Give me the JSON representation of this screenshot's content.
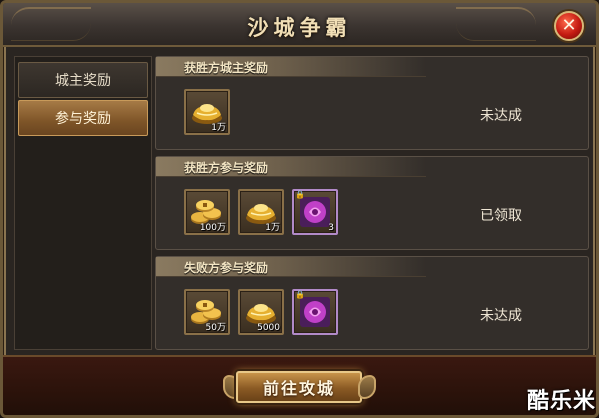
{
  "window": {
    "title": "沙城争霸",
    "close_symbol": "✕"
  },
  "sidebar": {
    "tabs": [
      {
        "label": "城主奖励",
        "active": false
      },
      {
        "label": "参与奖励",
        "active": true
      }
    ]
  },
  "panels": [
    {
      "title": "获胜方城主奖励",
      "status": "未达成",
      "items": [
        {
          "icon": "gold-ingot-icon",
          "qty": "1万"
        }
      ]
    },
    {
      "title": "获胜方参与奖励",
      "status": "已领取",
      "items": [
        {
          "icon": "gold-coins-icon",
          "qty": "100万"
        },
        {
          "icon": "gold-ingot-icon",
          "qty": "1万"
        },
        {
          "icon": "purple-skill-book-icon",
          "qty": "3",
          "locked": true
        }
      ]
    },
    {
      "title": "失败方参与奖励",
      "status": "未达成",
      "items": [
        {
          "icon": "gold-coins-icon",
          "qty": "50万"
        },
        {
          "icon": "gold-ingot-icon",
          "qty": "5000"
        },
        {
          "icon": "purple-skill-book-icon",
          "qty": "",
          "locked": true
        }
      ]
    }
  ],
  "footer": {
    "go_button": "前往攻城"
  },
  "watermark": "酷乐米",
  "colors": {
    "accent_gold": "#c8944a",
    "title_text": "#f1dfb6",
    "active_tab": "#8e6232",
    "close_red": "#c41b12",
    "epic_purple": "#b28ac8"
  }
}
